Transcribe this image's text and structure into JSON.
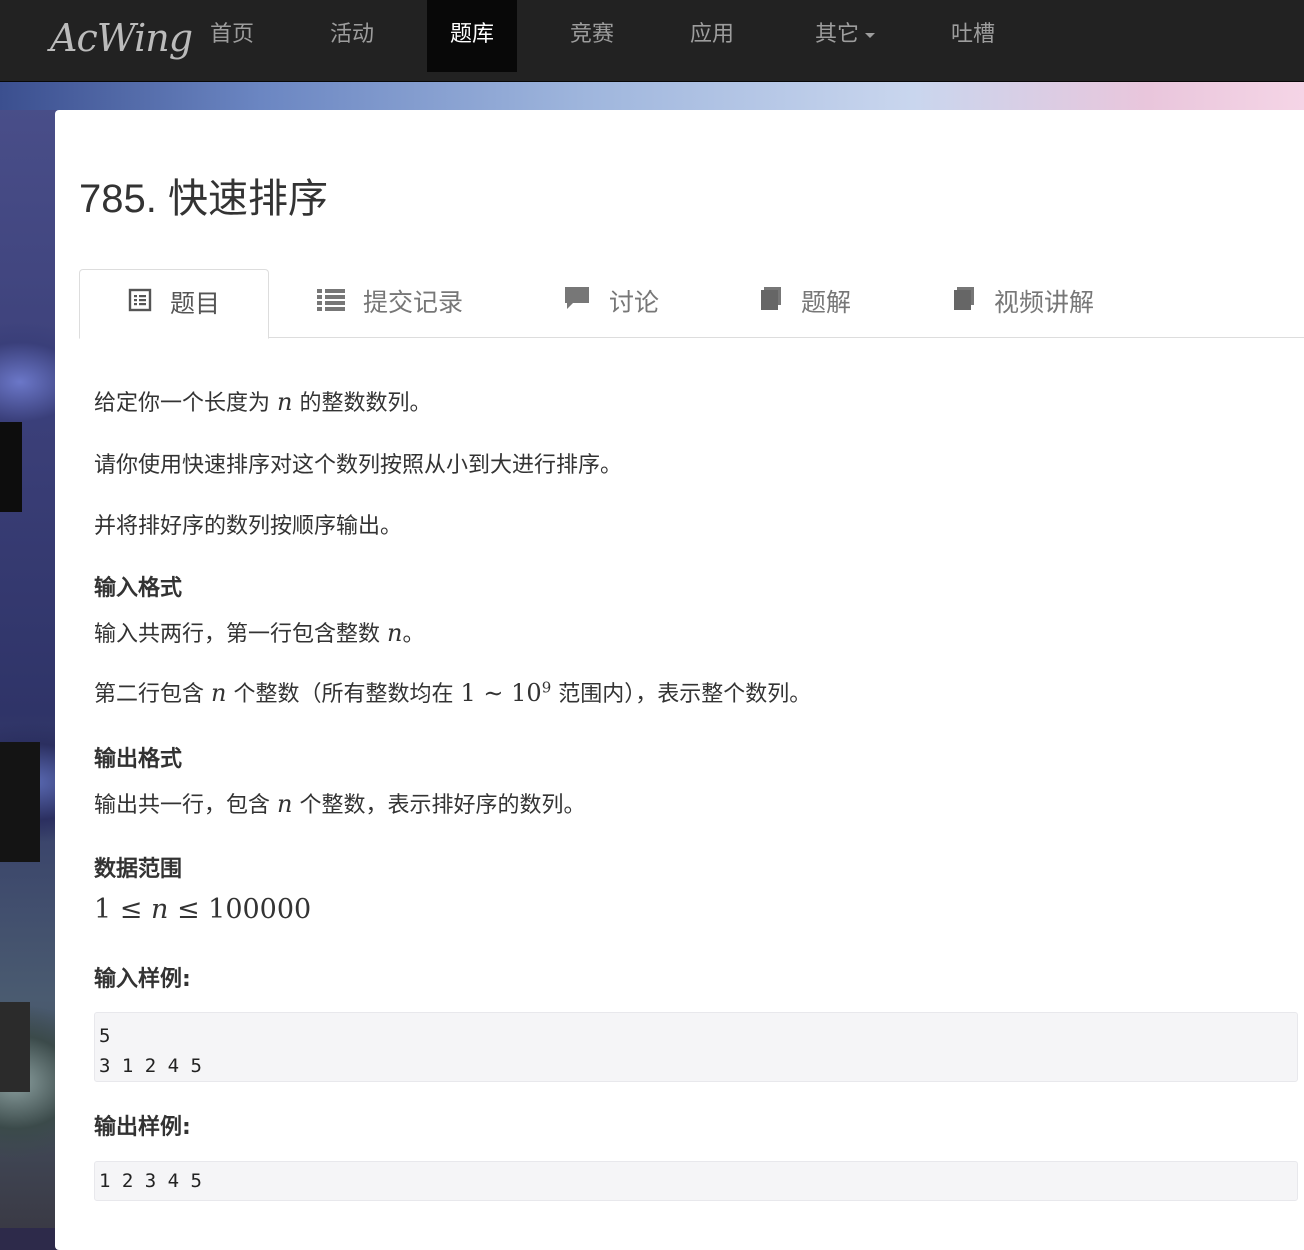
{
  "brand": "AcWing",
  "nav": {
    "items": [
      {
        "label": "首页"
      },
      {
        "label": "活动"
      },
      {
        "label": "题库",
        "active": true
      },
      {
        "label": "竞赛"
      },
      {
        "label": "应用"
      },
      {
        "label": "其它",
        "dropdown": true
      },
      {
        "label": "吐槽"
      }
    ]
  },
  "problem": {
    "title": "785. 快速排序",
    "tabs": [
      {
        "label": "题目",
        "icon": "list-alt-icon",
        "active": true
      },
      {
        "label": "提交记录",
        "icon": "list-icon"
      },
      {
        "label": "讨论",
        "icon": "comment-icon"
      },
      {
        "label": "题解",
        "icon": "book-icon"
      },
      {
        "label": "视频讲解",
        "icon": "book-icon"
      }
    ],
    "desc": {
      "p1_a": "给定你一个长度为",
      "p1_var": "n",
      "p1_b": "的整数数列。",
      "p2": "请你使用快速排序对这个数列按照从小到大进行排序。",
      "p3": "并将排好序的数列按顺序输出。"
    },
    "input_format": {
      "heading": "输入格式",
      "l1_a": "输入共两行，第一行包含整数",
      "l1_var": "n",
      "l1_b": "。",
      "l2_a": "第二行包含",
      "l2_var": "n",
      "l2_b": "个整数（所有整数均在",
      "l2_range": "1 ∼ 10",
      "l2_exp": "9",
      "l2_c": "范围内），表示整个数列。"
    },
    "output_format": {
      "heading": "输出格式",
      "l1_a": "输出共一行，包含",
      "l1_var": "n",
      "l1_b": "个整数，表示排好序的数列。"
    },
    "data_range": {
      "heading": "数据范围",
      "low": "1 ≤ ",
      "var": "n",
      "high": " ≤ 100000"
    },
    "sample_input": {
      "heading": "输入样例:",
      "text": "5\n3 1 2 4 5"
    },
    "sample_output": {
      "heading": "输出样例:",
      "text": "1 2 3 4 5"
    }
  }
}
